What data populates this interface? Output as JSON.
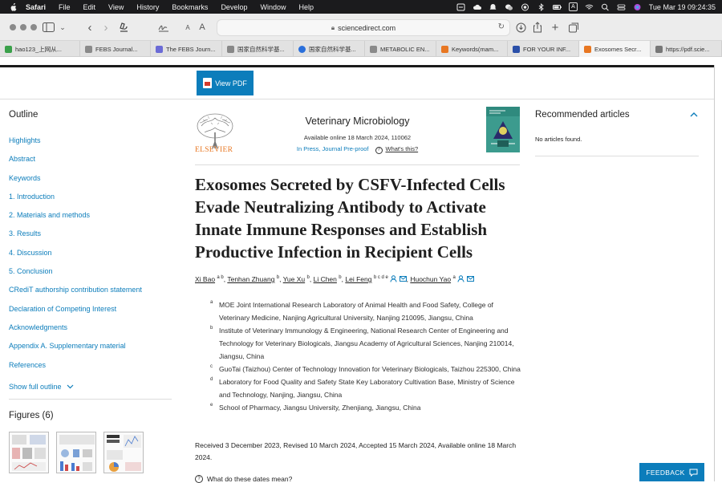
{
  "menubar": {
    "app": "Safari",
    "items": [
      "File",
      "Edit",
      "View",
      "History",
      "Bookmarks",
      "Develop",
      "Window",
      "Help"
    ],
    "clock": "Tue Mar 19  09:24:35",
    "input_source": "A"
  },
  "toolbar": {
    "url": "sciencedirect.com"
  },
  "tabs": [
    {
      "label": "hao123_上网从...",
      "color": "#3aa04a"
    },
    {
      "label": "FEBS Journal...",
      "color": "#8a8a8a"
    },
    {
      "label": "The FEBS Journ...",
      "color": "#6b6bd6"
    },
    {
      "label": "国家自然科学基...",
      "color": "#888888"
    },
    {
      "label": "国家自然科学基...",
      "color": "#2a6fdb"
    },
    {
      "label": "METABOLIC EN...",
      "color": "#8a8a8a"
    },
    {
      "label": "Keywords(mam...",
      "color": "#e87722"
    },
    {
      "label": "FOR YOUR INF...",
      "color": "#2a4fa8"
    },
    {
      "label": "Exosomes Secr...",
      "color": "#e87722"
    },
    {
      "label": "https://pdf.scie...",
      "color": "#777777"
    }
  ],
  "viewpdf": {
    "label": "View PDF"
  },
  "outline": {
    "heading": "Outline",
    "items": [
      "Highlights",
      "Abstract",
      "Keywords",
      "1. Introduction",
      "2. Materials and methods",
      "3. Results",
      "4. Discussion",
      "5. Conclusion",
      "CRediT authorship contribution statement",
      "Declaration of Competing Interest",
      "Acknowledgments",
      "Appendix A. Supplementary material",
      "References"
    ],
    "show_full": "Show full outline",
    "figures_heading": "Figures (6)"
  },
  "journal": {
    "publisher": "ELSEVIER",
    "name": "Veterinary Microbiology",
    "meta": "Available online 18 March 2024, 110062",
    "status": "In Press, Journal Pre-proof",
    "whats_this": "What's this?"
  },
  "article": {
    "title": "Exosomes Secreted by CSFV-Infected Cells Evade Neutralizing Antibody to Activate Innate Immune Responses and Establish Productive Infection in Recipient Cells",
    "authors": [
      {
        "name": "Xi Bao",
        "sup": "a b"
      },
      {
        "name": "Tenhan Zhuang",
        "sup": "b"
      },
      {
        "name": "Yue Xu",
        "sup": "b"
      },
      {
        "name": "Li Chen",
        "sup": "b"
      },
      {
        "name": "Lei Feng",
        "sup": "b c d e"
      },
      {
        "name": "Huochun Yao",
        "sup": "a"
      }
    ],
    "affiliations": [
      {
        "mark": "a",
        "text": "MOE Joint International Research Laboratory of Animal Health and Food Safety, College of Veterinary Medicine, Nanjing Agricultural University, Nanjing 210095, Jiangsu, China"
      },
      {
        "mark": "b",
        "text": "Institute of Veterinary Immunology & Engineering, National Research Center of Engineering and Technology for Veterinary Biologicals, Jiangsu Academy of Agricultural Sciences, Nanjing 210014, Jiangsu, China"
      },
      {
        "mark": "c",
        "text": "GuoTai (Taizhou) Center of Technology Innovation for Veterinary Biologicals, Taizhou 225300, China"
      },
      {
        "mark": "d",
        "text": "Laboratory for Food Quality and Safety State Key Laboratory Cultivation Base, Ministry of Science and Technology, Nanjing, Jiangsu, China"
      },
      {
        "mark": "e",
        "text": "School of Pharmacy, Jiangsu University, Zhenjiang, Jiangsu, China"
      }
    ],
    "dates": "Received 3 December 2023, Revised 10 March 2024, Accepted 15 March 2024, Available online 18 March 2024.",
    "what_dates": "What do these dates mean?"
  },
  "recommended": {
    "heading": "Recommended articles",
    "empty": "No articles found."
  },
  "feedback": {
    "label": "FEEDBACK"
  },
  "colors": {
    "link": "#0c7dbb",
    "brand": "#e87722",
    "menubar": "#1b1b1d"
  }
}
